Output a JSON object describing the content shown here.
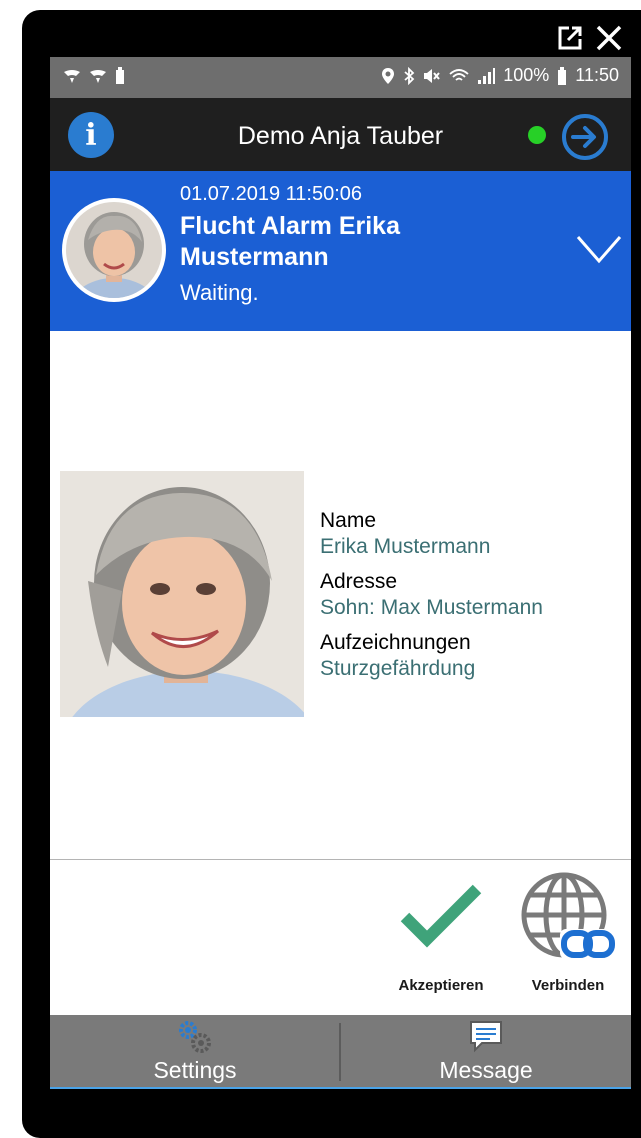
{
  "status_bar": {
    "battery": "100%",
    "time": "11:50"
  },
  "app_bar": {
    "title": "Demo Anja Tauber",
    "info_icon": "info-icon",
    "forward_icon": "arrow-right-circle-icon",
    "online_color": "#27d027"
  },
  "alarm": {
    "timestamp": "01.07.2019 11:50:06",
    "title": "Flucht Alarm Erika Mustermann",
    "status": "Waiting.",
    "background": "#1b5fd4"
  },
  "details": {
    "name_label": "Name",
    "name_value": "Erika Mustermann",
    "address_label": "Adresse",
    "address_value": "Sohn: Max Mustermann",
    "records_label": "Aufzeichnungen",
    "records_value": "Sturzgefährdung"
  },
  "actions": {
    "accept_label": "Akzeptieren",
    "connect_label": "Verbinden"
  },
  "bottom_nav": {
    "settings_label": "Settings",
    "message_label": "Message"
  }
}
